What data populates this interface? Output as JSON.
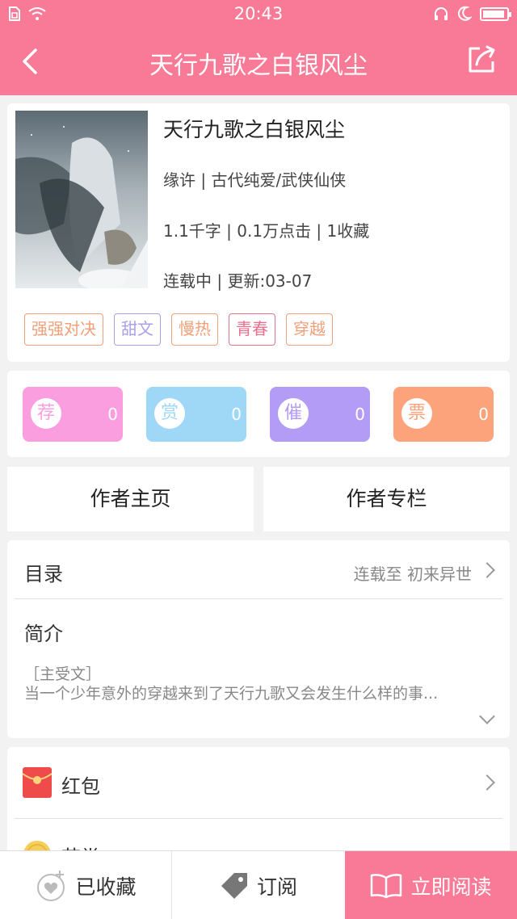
{
  "status_bar": {
    "time": "20:43"
  },
  "header": {
    "title": "天行九歌之白银风尘"
  },
  "book": {
    "title": "天行九歌之白银风尘",
    "meta_author": "缘许 | 古代纯爱/武侠仙侠",
    "meta_stats": "1.1千字 | 0.1万点击 | 1收藏",
    "meta_status": "连载中 | 更新:03-07",
    "tags": [
      {
        "label": "强强对决",
        "color": "#f2a07a"
      },
      {
        "label": "甜文",
        "color": "#a9a0e8"
      },
      {
        "label": "慢热",
        "color": "#f2a07a"
      },
      {
        "label": "青春",
        "color": "#e8708e"
      },
      {
        "label": "穿越",
        "color": "#f2a07a"
      }
    ]
  },
  "actions": [
    {
      "icon_char": "荐",
      "count": "0",
      "color": "#fb9ee0"
    },
    {
      "icon_char": "赏",
      "count": "0",
      "color": "#9fd8f7"
    },
    {
      "icon_char": "催",
      "count": "0",
      "color": "#b39cf6"
    },
    {
      "icon_char": "票",
      "count": "0",
      "color": "#fca37c"
    }
  ],
  "author_buttons": {
    "home": "作者主页",
    "column": "作者专栏"
  },
  "toc": {
    "label": "目录",
    "status": "连载至 初来异世"
  },
  "intro": {
    "label": "简介",
    "line1": "［主受文］",
    "line2": "当一个少年意外的穿越来到了天行九歌又会发生什么样的事..."
  },
  "extras": {
    "red_packet": "红包",
    "partial_label": "节堂"
  },
  "bottom_bar": {
    "favorited": "已收藏",
    "subscribe": "订阅",
    "read_now": "立即阅读"
  }
}
